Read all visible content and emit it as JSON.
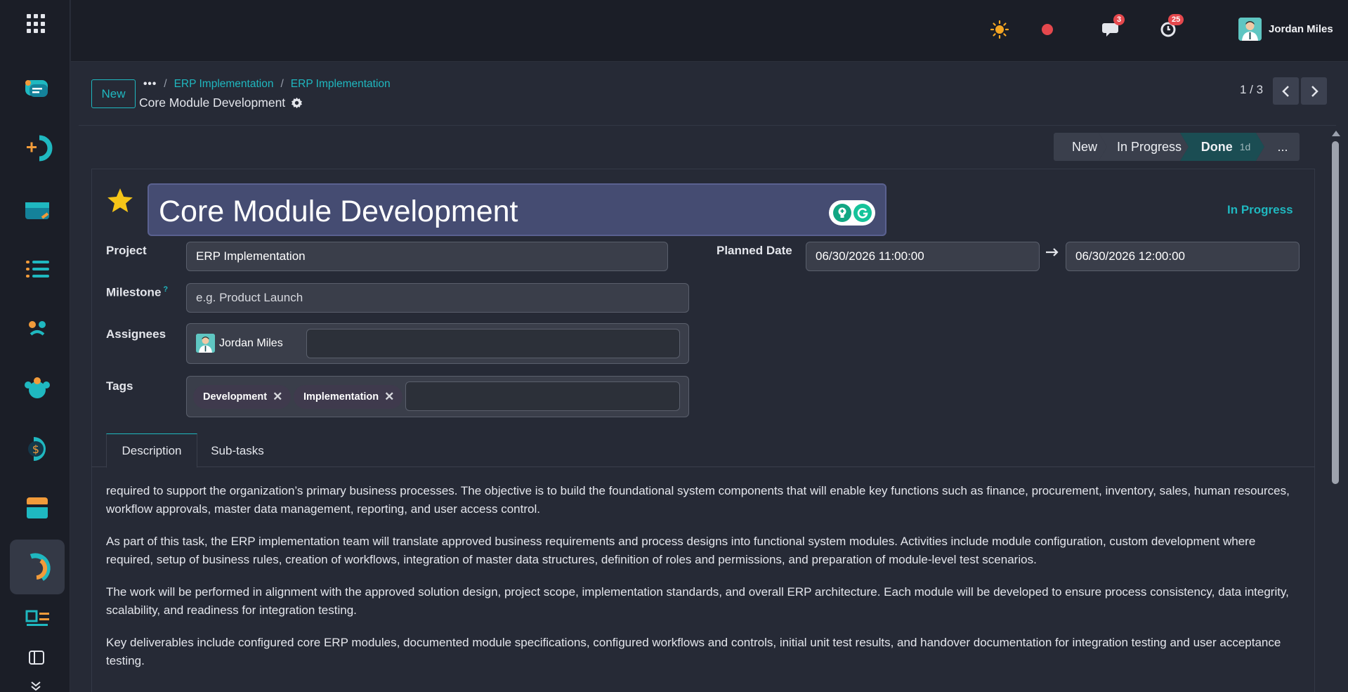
{
  "topbar": {
    "chat_badge": "3",
    "activity_badge": "25",
    "user_name": "Jordan Miles"
  },
  "control_panel": {
    "new_label": "New",
    "breadcrumb_dots": "•••",
    "breadcrumbs": [
      "ERP Implementation",
      "ERP Implementation"
    ],
    "record_title": "Core Module Development",
    "pager": "1 / 3"
  },
  "statusbar": {
    "stages": [
      "New",
      "In Progress",
      "Done",
      "..."
    ],
    "done_duration": "1d"
  },
  "form": {
    "title": "Core Module Development",
    "stage_label": "In Progress",
    "project_label": "Project",
    "project_value": "ERP Implementation",
    "milestone_label": "Milestone",
    "milestone_help": "?",
    "milestone_placeholder": "e.g. Product Launch",
    "assignees_label": "Assignees",
    "assignee_name": "Jordan Miles",
    "tags_label": "Tags",
    "tags": [
      "Development",
      "Implementation"
    ],
    "planned_date_label": "Planned Date",
    "planned_start": "06/30/2026 11:00:00",
    "planned_end": "06/30/2026 12:00:00"
  },
  "tabs": [
    "Description",
    "Sub-tasks"
  ],
  "description": [
    "required to support the organization’s primary business processes. The objective is to build the foundational system components that will enable key functions such as finance, procurement, inventory, sales, human resources, workflow approvals, master data management, reporting, and user access control.",
    "As part of this task, the ERP implementation team will translate approved business requirements and process designs into functional system modules. Activities include module configuration, custom development where required, setup of business rules, creation of workflows, integration of master data structures, definition of roles and permissions, and preparation of module-level test scenarios.",
    "The work will be performed in alignment with the approved solution design, project scope, implementation standards, and overall ERP architecture. Each module will be developed to ensure process consistency, data integrity, scalability, and readiness for integration testing.",
    "Key deliverables include configured core ERP modules, documented module specifications, configured workflows and controls, initial unit test results, and handover documentation for integration testing and user acceptance testing."
  ],
  "colors": {
    "accent": "#1fb8c0",
    "badge": "#e5484d",
    "star": "#f5c518",
    "title_field": "#454c72"
  },
  "icons": [
    "apps-grid-icon",
    "sun-icon",
    "status-dot-icon",
    "chat-icon",
    "clock-icon",
    "gear-icon",
    "star-icon",
    "chevron-left-icon",
    "chevron-right-icon",
    "arrow-right-icon",
    "close-icon",
    "sidebar-toggle-icon",
    "chevron-double-down-icon"
  ]
}
